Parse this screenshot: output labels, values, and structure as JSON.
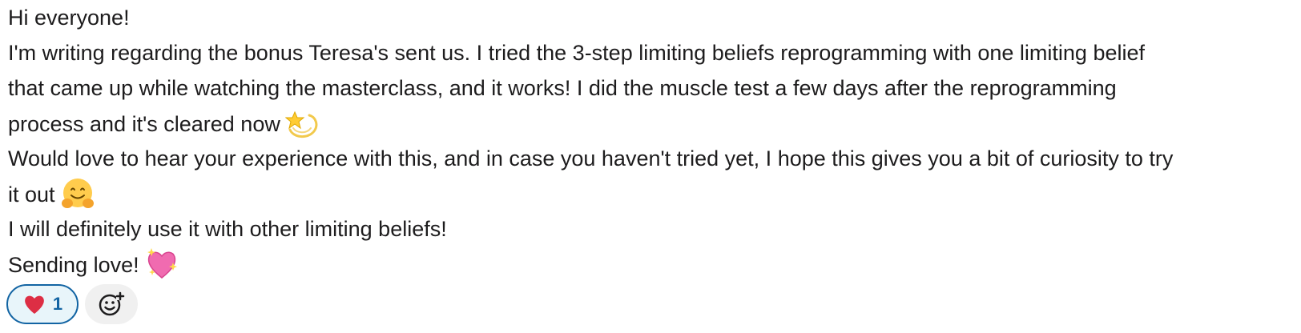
{
  "message": {
    "lines": [
      "Hi everyone!",
      "I'm writing regarding the bonus Teresa's sent us. I tried the 3-step limiting beliefs reprogramming  with one limiting belief",
      "that came up while watching the masterclass, and it works! I did the muscle test a few days after the reprogramming",
      "process and it's cleared now",
      "Would love to hear your experience with this, and in case you haven't tried yet, I hope this gives you a bit of curiosity to try",
      "it out",
      "I will definitely use it with other limiting beliefs!",
      "Sending love!"
    ],
    "emojis": {
      "line4": "dizzy-star-emoji",
      "line6": "hugging-face-emoji",
      "line8": "sparkling-heart-emoji"
    }
  },
  "reactions": [
    {
      "emoji": "red-heart-emoji",
      "count": "1",
      "selected": true
    }
  ],
  "add_reaction": {
    "icon": "add-emoji-icon"
  },
  "colors": {
    "text": "#1d1c1d",
    "reaction_border": "#1264a3",
    "reaction_bg": "#e8f5fa",
    "add_bg": "#f0f0f0"
  }
}
